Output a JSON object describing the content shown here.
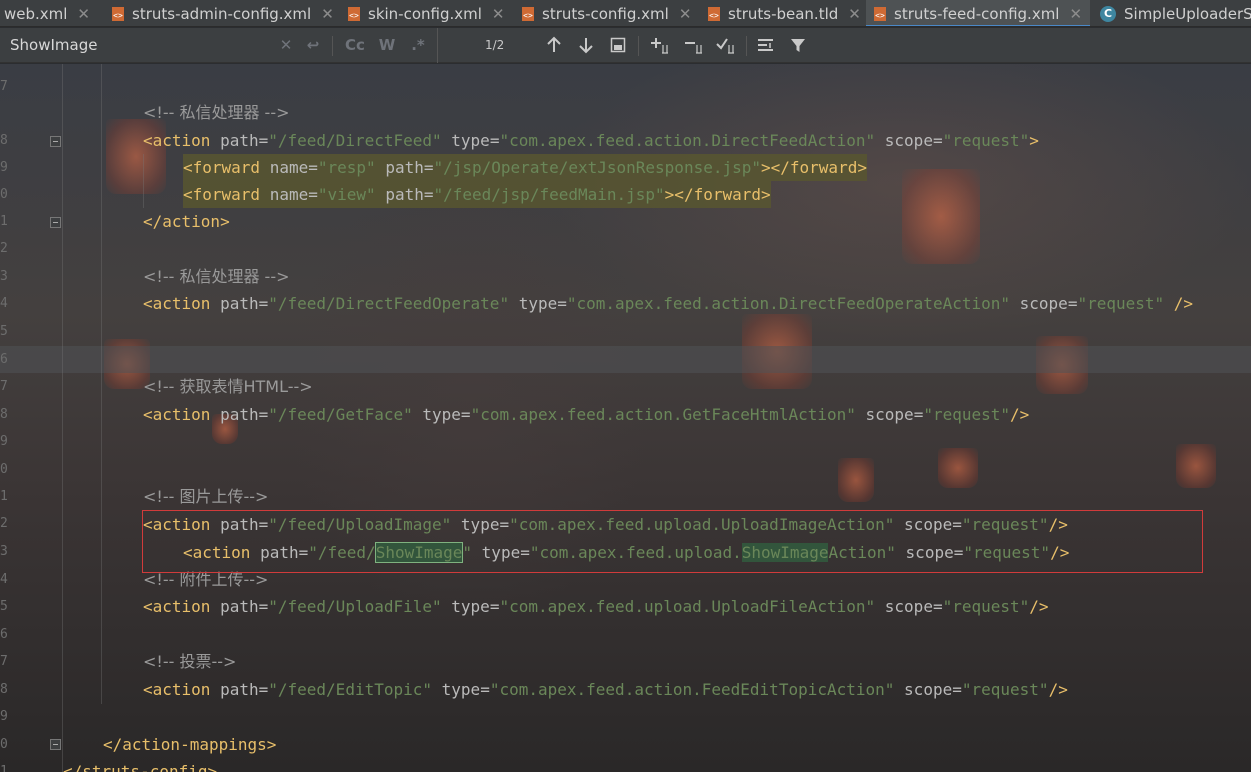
{
  "tabs": [
    {
      "label": "web.xml",
      "icon": "xml-file-icon",
      "closable": true
    },
    {
      "label": "struts-admin-config.xml",
      "icon": "xml-file-icon",
      "closable": true
    },
    {
      "label": "skin-config.xml",
      "icon": "xml-file-icon",
      "closable": true
    },
    {
      "label": "struts-config.xml",
      "icon": "xml-file-icon",
      "closable": true
    },
    {
      "label": "struts-bean.tld",
      "icon": "tld-file-icon",
      "closable": true
    },
    {
      "label": "struts-feed-config.xml",
      "icon": "xml-file-icon",
      "closable": true,
      "active": true
    },
    {
      "label": "SimpleUploaderS",
      "icon": "java-class-icon",
      "closable": false
    }
  ],
  "search": {
    "query": "ShowImage",
    "match_count": "1/2",
    "icons": [
      "clear-search-icon",
      "replace-toggle-icon",
      "match-case-icon",
      "whole-words-icon",
      "regex-icon",
      "previous-match-icon",
      "next-match-icon",
      "select-all-occurrences-icon",
      "add-selection-icon",
      "remove-selection-icon",
      "toggle-selection-icon",
      "multiline-toggle-icon",
      "filter-icon"
    ],
    "match_case_label": "Cc",
    "whole_words_label": "W",
    "regex_label": ".*"
  },
  "gutter": {
    "line_number_tails": [
      "7",
      "8",
      "9",
      "0",
      "1",
      "2",
      "3",
      "4",
      "5",
      "6",
      "7",
      "8",
      "9",
      "0",
      "1",
      "2",
      "3",
      "4",
      "5",
      "6",
      "7",
      "8",
      "9",
      "0",
      "1"
    ]
  },
  "code": {
    "l1_comment": "<!-- 私信处理器 -->",
    "l2": {
      "tag": "<action",
      "a1": "path",
      "v1": "\"/feed/DirectFeed\"",
      "a2": "type",
      "v2": "\"com.apex.feed.action.DirectFeedAction\"",
      "a3": "scope",
      "v3": "\"request\"",
      "end": ">"
    },
    "l3": {
      "tag": "<forward",
      "a1": "name",
      "v1": "\"resp\"",
      "a2": "path",
      "v2": "\"/jsp/Operate/extJsonResponse.jsp\"",
      "end": "></forward>"
    },
    "l4": {
      "tag": "<forward",
      "a1": "name",
      "v1": "\"view\"",
      "a2": "path",
      "v2": "\"/feed/jsp/feedMain.jsp\"",
      "end": "></forward>"
    },
    "l5_close": "</action>",
    "l7_comment": "<!-- 私信处理器 -->",
    "l8": {
      "tag": "<action",
      "a1": "path",
      "v1": "\"/feed/DirectFeedOperate\"",
      "a2": "type",
      "v2": "\"com.apex.feed.action.DirectFeedOperateAction\"",
      "a3": "scope",
      "v3": "\"request\"",
      "end": " />"
    },
    "l11_comment": "<!-- 获取表情HTML-->",
    "l12": {
      "tag": "<action",
      "a1": "path",
      "v1": "\"/feed/GetFace\"",
      "a2": "type",
      "v2": "\"com.apex.feed.action.GetFaceHtmlAction\"",
      "a3": "scope",
      "v3": "\"request\"",
      "end": "/>"
    },
    "l15_comment": "<!-- 图片上传-->",
    "l16": {
      "tag": "<action",
      "a1": "path",
      "v1": "\"/feed/UploadImage\"",
      "a2": "type",
      "v2": "\"com.apex.feed.upload.UploadImageAction\"",
      "a3": "scope",
      "v3": "\"request\"",
      "end": "/>"
    },
    "l17": {
      "tag": "<action",
      "a1": "path",
      "v1a": "\"/feed/",
      "v1m": "ShowImage",
      "v1b": "\"",
      "a2": "type",
      "v2a": "\"com.apex.feed.upload.",
      "v2m": "ShowImage",
      "v2b": "Action\"",
      "a3": "scope",
      "v3": "\"request\"",
      "end": "/>"
    },
    "l18_comment": "<!-- 附件上传-->",
    "l19": {
      "tag": "<action",
      "a1": "path",
      "v1": "\"/feed/UploadFile\"",
      "a2": "type",
      "v2": "\"com.apex.feed.upload.UploadFileAction\"",
      "a3": "scope",
      "v3": "\"request\"",
      "end": "/>"
    },
    "l21_comment": "<!-- 投票-->",
    "l22": {
      "tag": "<action",
      "a1": "path",
      "v1": "\"/feed/EditTopic\"",
      "a2": "type",
      "v2": "\"com.apex.feed.action.FeedEditTopicAction\"",
      "a3": "scope",
      "v3": "\"request\"",
      "end": "/>"
    },
    "l24_close": "</action-mappings>",
    "l25_close": "</struts-config>"
  },
  "colors": {
    "tag": "#e8bf6a",
    "attribute": "#bababa",
    "value": "#6a8759",
    "comment": "#8a8a8a",
    "match_highlight": "#32593d",
    "annotation_box": "#d13b3b",
    "active_tab_underline": "#4a88c7"
  }
}
